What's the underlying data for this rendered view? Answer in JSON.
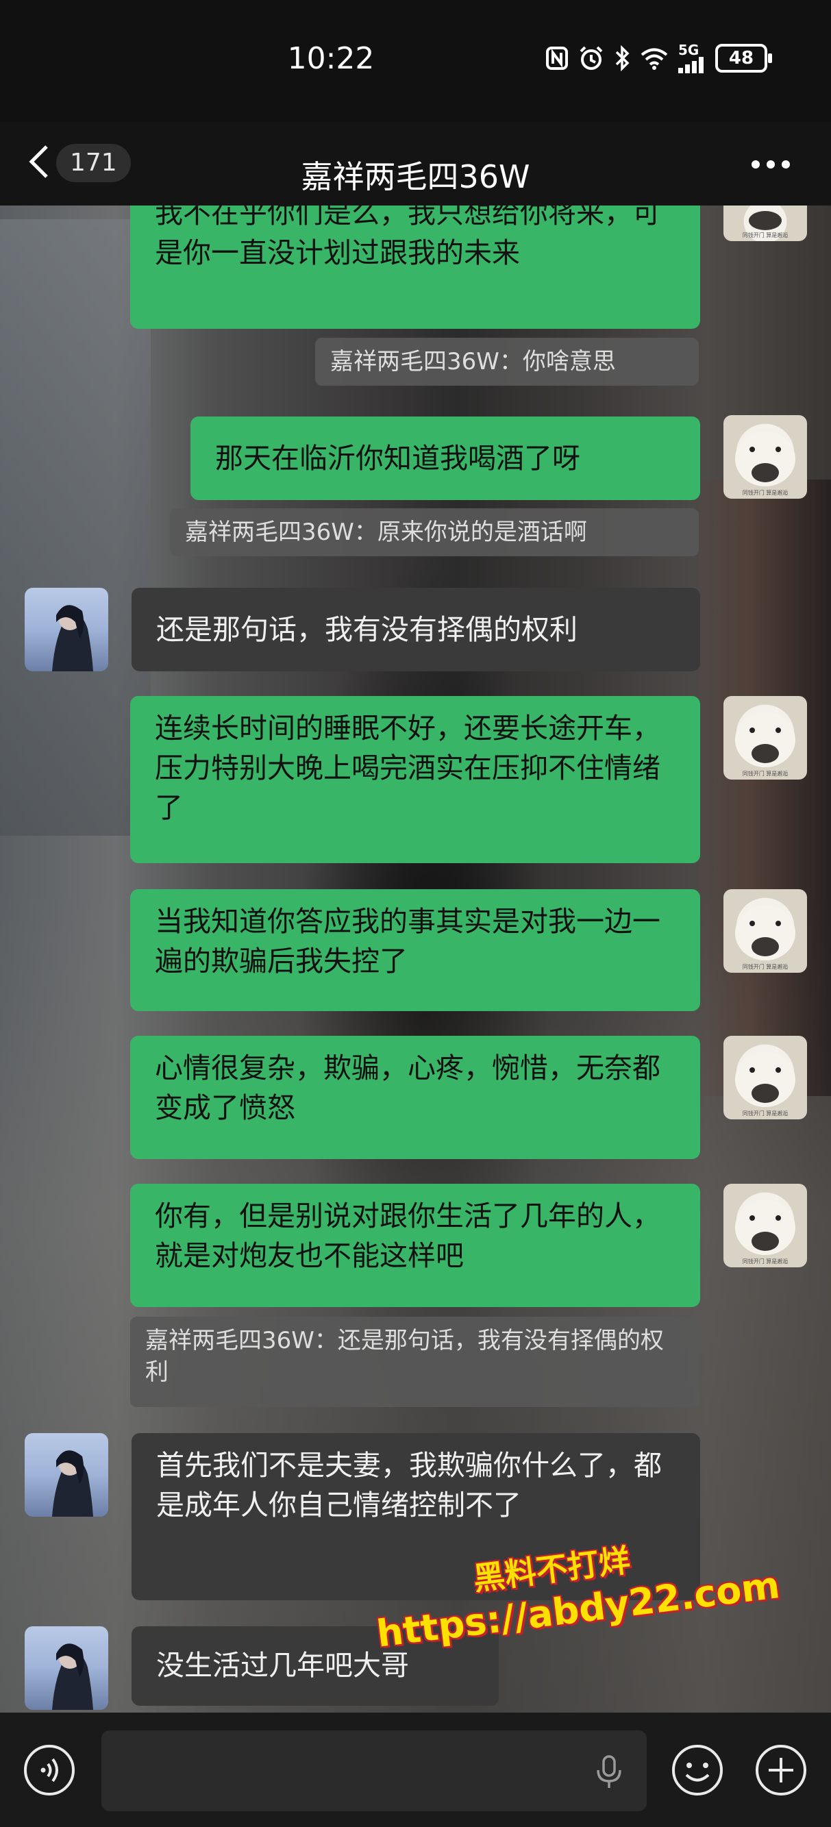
{
  "status_bar": {
    "time": "10:22",
    "network": "5G",
    "battery": "48",
    "icons": [
      "nfc-icon",
      "alarm-icon",
      "bluetooth-icon",
      "wifi-icon",
      "signal-icon",
      "battery-icon"
    ]
  },
  "header": {
    "back_badge": "171",
    "title": "嘉祥两毛四36W",
    "more_icon": "more-icon"
  },
  "messages": [
    {
      "side": "right",
      "type": "text",
      "text": "我不在乎你们是么，我只想给你将来，可是你一直没计划过跟我的未来"
    },
    {
      "side": "right",
      "type": "quote",
      "text": "嘉祥两毛四36W：你啥意思"
    },
    {
      "side": "right",
      "type": "text",
      "text": "那天在临沂你知道我喝酒了呀"
    },
    {
      "side": "right",
      "type": "quote",
      "text": "嘉祥两毛四36W：原来你说的是酒话啊"
    },
    {
      "side": "left",
      "type": "text",
      "text": "还是那句话，我有没有择偶的权利"
    },
    {
      "side": "right",
      "type": "text",
      "text": "连续长时间的睡眠不好，还要长途开车，压力特别大晚上喝完酒实在压抑不住情绪了"
    },
    {
      "side": "right",
      "type": "text",
      "text": "当我知道你答应我的事其实是对我一边一遍的欺骗后我失控了"
    },
    {
      "side": "right",
      "type": "text",
      "text": "心情很复杂，欺骗，心疼，惋惜，无奈都变成了愤怒"
    },
    {
      "side": "right",
      "type": "text",
      "text": "你有，但是别说对跟你生活了几年的人，就是对炮友也不能这样吧"
    },
    {
      "side": "right",
      "type": "quote",
      "text": "嘉祥两毛四36W：还是那句话，我有没有择偶的权利"
    },
    {
      "side": "left",
      "type": "text",
      "text": "首先我们不是夫妻，我欺骗你什么了，都是成年人你自己情绪控制不了"
    },
    {
      "side": "left",
      "type": "text",
      "text": "没生活过几年吧大哥"
    }
  ],
  "avatar_caption": "同钱开门 算是邂逅",
  "watermark": {
    "line1": "黑料不打烊",
    "line2": "https://abdy22.com"
  },
  "input_bar": {
    "placeholder": "",
    "icons": [
      "voice-icon",
      "mic-icon",
      "emoji-icon",
      "plus-icon"
    ]
  },
  "colors": {
    "my_bubble": "#39b567",
    "their_bubble": "#3a3a3a",
    "quote_bg": "#585858",
    "header_bg": "#141414",
    "watermark_fill": "#ffe100",
    "watermark_outline": "#c3202a"
  }
}
